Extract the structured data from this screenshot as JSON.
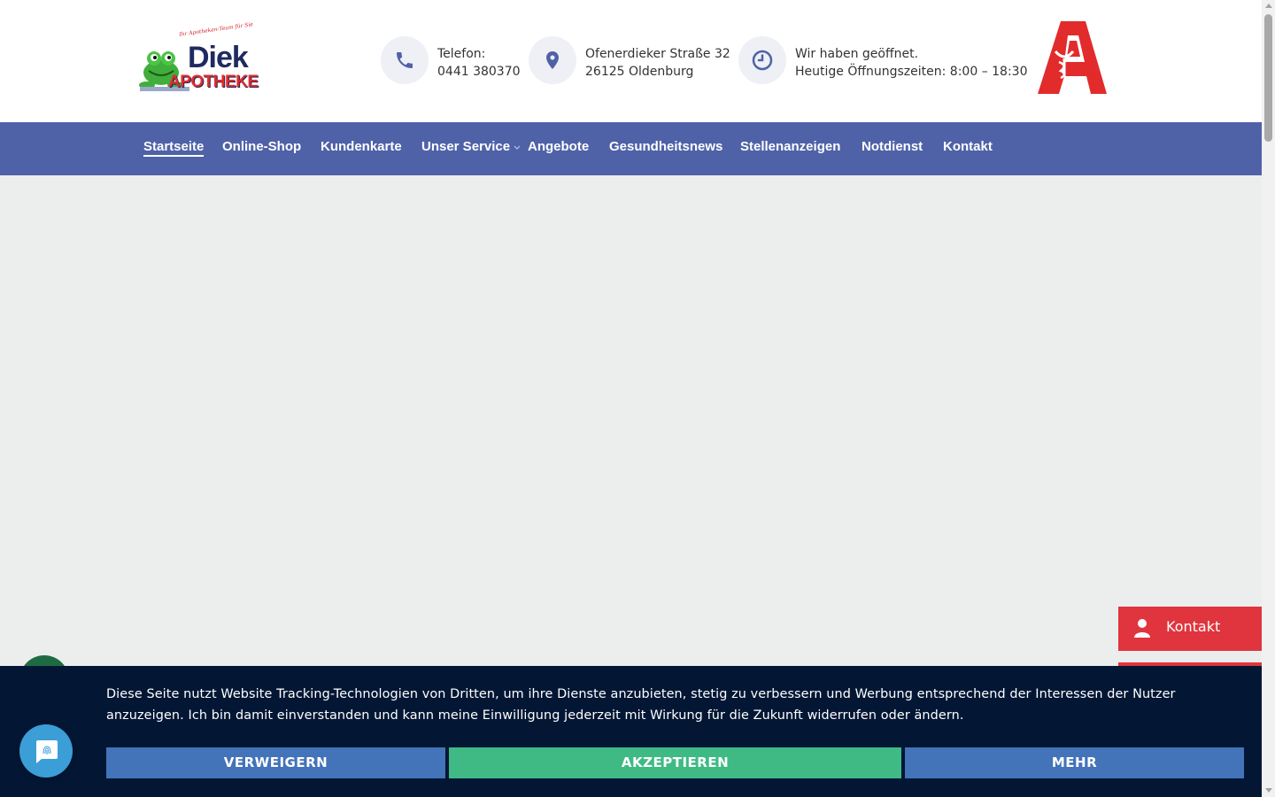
{
  "header": {
    "logo": {
      "tagline": "Ihr Apotheken-Team für Sie",
      "name": "Diek",
      "subname": "APOTHEKE"
    },
    "phone": {
      "label": "Telefon:",
      "number": "0441 380370",
      "icon": "phone-icon"
    },
    "address": {
      "street": "Ofenerdieker Straße 32",
      "city": "26125 Oldenburg",
      "icon": "location-pin-icon"
    },
    "hours": {
      "status": "Wir haben geöffnet.",
      "today": "Heutige Öffnungszeiten: 8:00 – 18:30",
      "icon": "clock-icon"
    },
    "apotheke_logo": "apotheke-a-logo"
  },
  "nav": {
    "items": [
      {
        "label": "Startseite",
        "active": true
      },
      {
        "label": "Online-Shop"
      },
      {
        "label": "Kundenkarte"
      },
      {
        "label": "Unser Service",
        "has_dropdown": true
      },
      {
        "label": "Angebote"
      },
      {
        "label": "Gesundheitsnews"
      },
      {
        "label": "Stellenanzeigen"
      },
      {
        "label": "Notdienst"
      },
      {
        "label": "Kontakt"
      }
    ]
  },
  "side_tab": {
    "label": "Kontakt",
    "icon": "user-icon"
  },
  "cookie": {
    "text": "Diese Seite nutzt Website Tracking-Technologien von Dritten, um ihre Dienste anzubieten, stetig zu verbessern und Werbung entsprechend der Interessen der Nutzer anzuzeigen. Ich bin damit einverstanden und kann meine Einwilligung jederzeit mit Wirkung für die Zukunft widerrufen oder ändern.",
    "refuse": "VERWEIGERN",
    "accept": "AKZEPTIEREN",
    "more": "MEHR"
  },
  "colors": {
    "nav_bg": "#4f62a8",
    "cookie_bg": "#031735",
    "button_blue": "#4373b9",
    "button_green": "#3fba85",
    "contact_red": "#e0353e",
    "apotheke_red": "#e22b2b"
  }
}
